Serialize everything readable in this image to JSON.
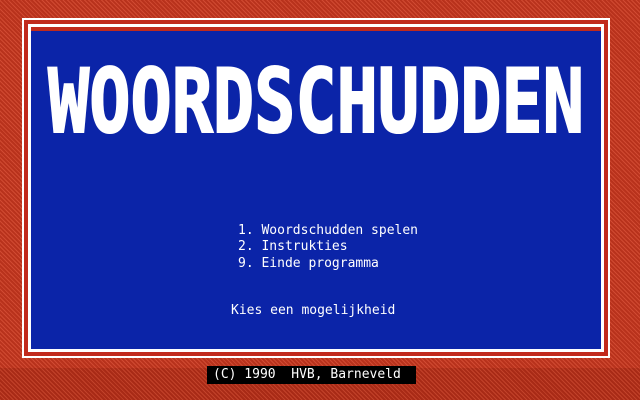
{
  "game": {
    "title": "WOORDSCHUDDEN",
    "menu": [
      {
        "label": "1. Woordschudden spelen"
      },
      {
        "label": "2. Instrukties"
      },
      {
        "label": "9. Einde programma"
      }
    ],
    "prompt": "Kies een mogelijkheid",
    "copyright": "(C) 1990  HVB, Barneveld"
  },
  "colors": {
    "border_red": "#b8321c",
    "panel_blue": "#0b24a8",
    "frame_white": "#ffffff",
    "text_white": "#ffffff",
    "status_black": "#000000"
  }
}
